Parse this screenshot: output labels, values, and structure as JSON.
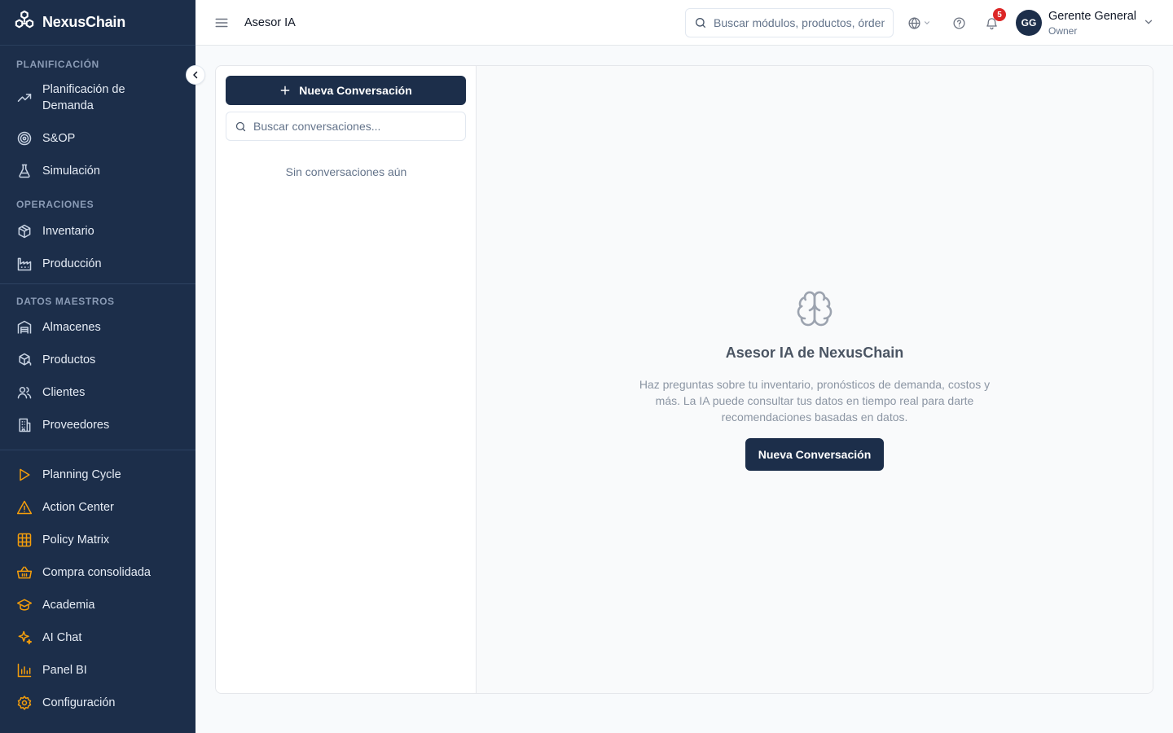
{
  "app": {
    "name": "NexusChain"
  },
  "colors": {
    "sidebar_bg": "#1c2e4a",
    "accent_orange": "#f59e0b",
    "badge_red": "#dc2626"
  },
  "sidebar": {
    "sections": [
      {
        "title": "PLANIFICACIÓN",
        "items": [
          {
            "label": "Planificación de Demanda",
            "icon": "trending-up-icon"
          },
          {
            "label": "S&OP",
            "icon": "target-icon"
          },
          {
            "label": "Simulación",
            "icon": "flask-icon"
          }
        ]
      },
      {
        "title": "OPERACIONES",
        "items": [
          {
            "label": "Inventario",
            "icon": "package-icon"
          },
          {
            "label": "Producción",
            "icon": "factory-icon"
          }
        ]
      },
      {
        "title": "DATOS MAESTROS",
        "items": [
          {
            "label": "Almacenes",
            "icon": "warehouse-icon"
          },
          {
            "label": "Productos",
            "icon": "boxes-icon"
          },
          {
            "label": "Clientes",
            "icon": "users-icon"
          },
          {
            "label": "Proveedores",
            "icon": "building-icon"
          }
        ]
      },
      {
        "title": "",
        "items": [
          {
            "label": "Planning Cycle",
            "icon": "play-icon"
          },
          {
            "label": "Action Center",
            "icon": "alert-triangle-icon"
          },
          {
            "label": "Policy Matrix",
            "icon": "grid-icon"
          },
          {
            "label": "Compra consolidada",
            "icon": "basket-icon"
          },
          {
            "label": "Academia",
            "icon": "graduation-cap-icon"
          },
          {
            "label": "AI Chat",
            "icon": "sparkles-icon"
          },
          {
            "label": "Panel BI",
            "icon": "bar-chart-icon"
          },
          {
            "label": "Configuración",
            "icon": "gear-icon"
          }
        ]
      }
    ]
  },
  "topbar": {
    "title": "Asesor IA",
    "search_placeholder": "Buscar módulos, productos, órdenes...",
    "notifications_count": "5",
    "user": {
      "initials": "GG",
      "name": "Gerente General",
      "role": "Owner"
    }
  },
  "conversations": {
    "new_button": "Nueva Conversación",
    "search_placeholder": "Buscar conversaciones...",
    "empty_text": "Sin conversaciones aún"
  },
  "chat": {
    "empty_title": "Asesor IA de NexusChain",
    "empty_description": "Haz preguntas sobre tu inventario, pronósticos de demanda, costos y más. La IA puede consultar tus datos en tiempo real para darte recomendaciones basadas en datos.",
    "cta_button": "Nueva Conversación",
    "icon": "brain-icon"
  }
}
